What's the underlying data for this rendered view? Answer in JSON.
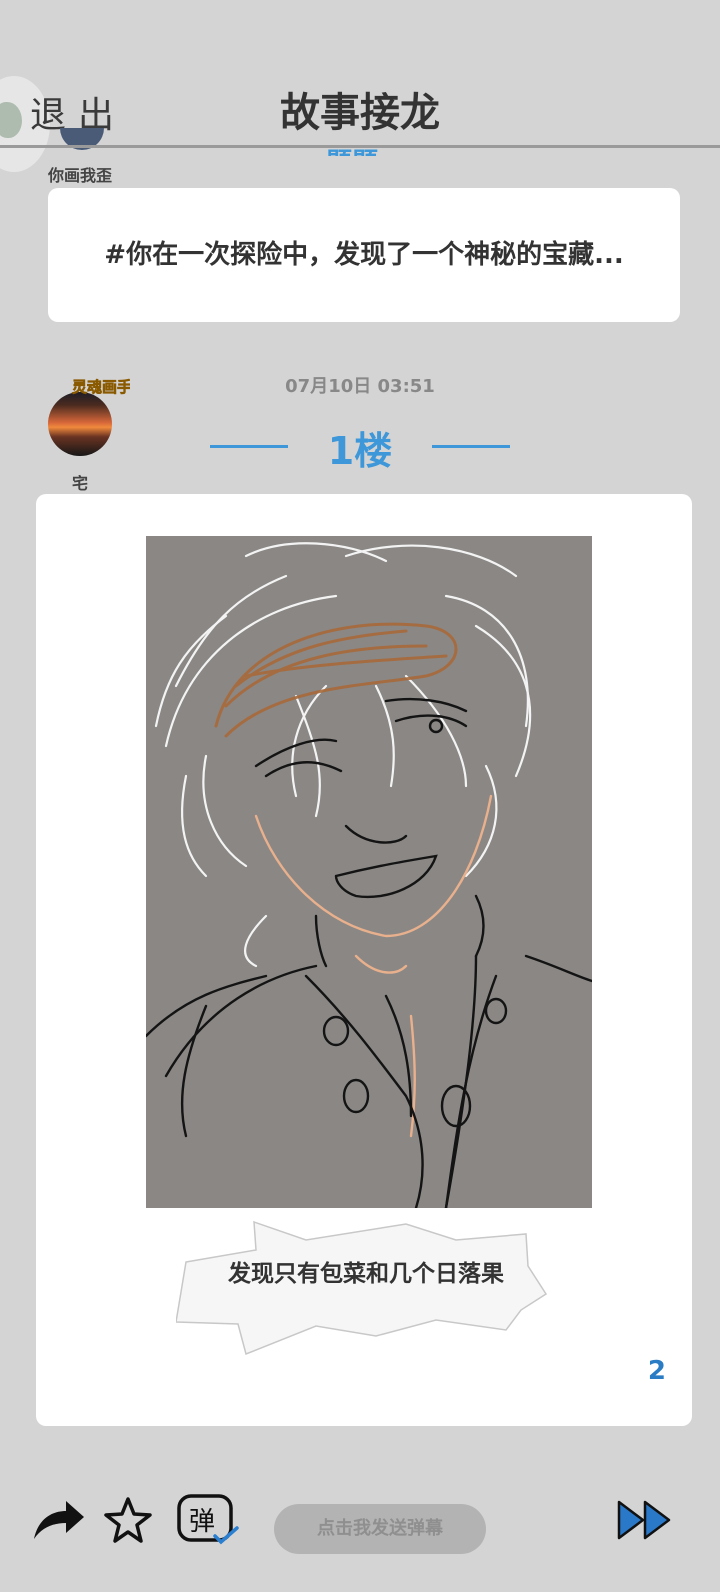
{
  "header": {
    "exit_label": "退出",
    "title": "故事接龙",
    "peek_floor": "题题"
  },
  "topic": {
    "author": "你画我歪",
    "text": "#你在一次探险中，发现了一个神秘的宝藏..."
  },
  "post": {
    "time": "07月10日  03:51",
    "floor": "1楼",
    "author": "宅",
    "badge_text": "灵魂画手",
    "caption": "发现只有包菜和几个日落果",
    "page_count": "2"
  },
  "toolbar": {
    "share_icon": "share-arrow-icon",
    "star_icon": "star-outline-icon",
    "danmu_label": "弹",
    "danmu_placeholder": "点击我发送弹幕",
    "next_icon": "fast-forward-icon"
  },
  "colors": {
    "accent": "#3d97d8",
    "background": "#d4d4d4",
    "card": "#ffffff",
    "drawing_bg": "#8a8785"
  }
}
